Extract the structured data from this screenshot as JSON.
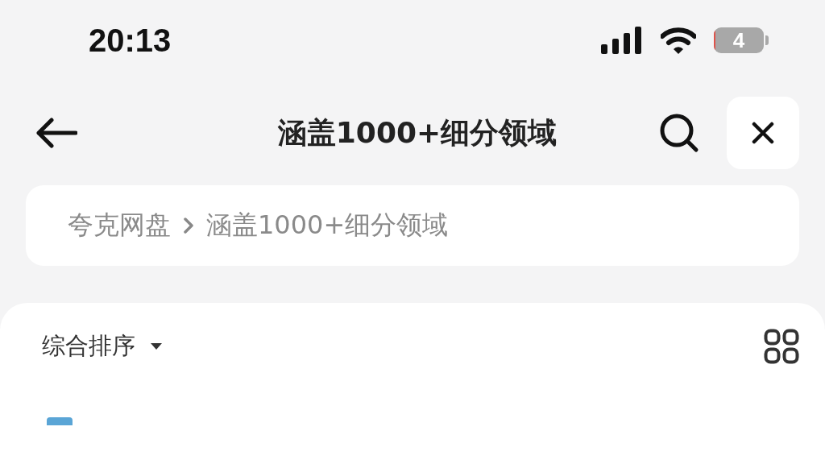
{
  "status_bar": {
    "time": "20:13",
    "battery": {
      "level": 0.04,
      "reading": "4"
    }
  },
  "header": {
    "title": "涵盖1000+细分领域"
  },
  "breadcrumb": [
    {
      "label": "夸克网盘"
    },
    {
      "label": "涵盖1000+细分领域"
    }
  ],
  "sort": {
    "label": "综合排序"
  }
}
